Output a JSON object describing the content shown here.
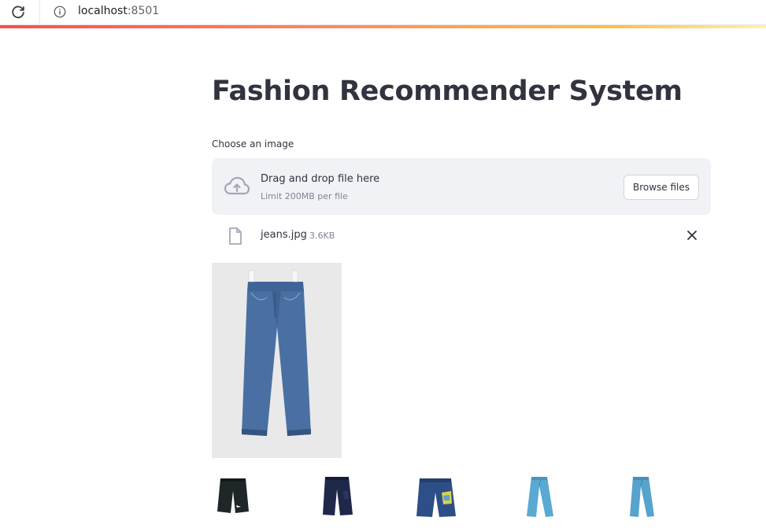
{
  "browser": {
    "host": "localhost",
    "port": ":8501"
  },
  "page": {
    "title": "Fashion Recommender System"
  },
  "uploader": {
    "label": "Choose an image",
    "drop_text": "Drag and drop file here",
    "limit_text": "Limit 200MB per file",
    "browse_label": "Browse files"
  },
  "file": {
    "name": "jeans.jpg",
    "size": "3.6KB"
  },
  "icons": {
    "reload": "reload-icon",
    "info": "info-icon",
    "upload": "cloud-upload-icon",
    "file": "file-icon",
    "close": "close-icon"
  },
  "colors": {
    "accent": "#ff4b4b",
    "denim": "#4a6fa0",
    "dropzone_bg": "#f0f2f6",
    "text": "#31333f"
  }
}
